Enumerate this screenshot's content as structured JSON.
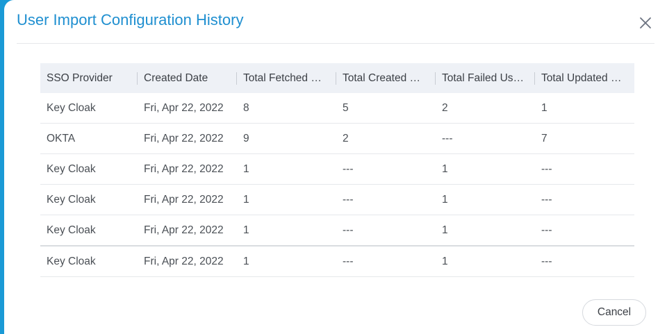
{
  "dialog": {
    "title": "User Import Configuration History",
    "cancel_label": "Cancel"
  },
  "table": {
    "columns": [
      "SSO Provider",
      "Created Date",
      "Total Fetched Users",
      "Total Created Users",
      "Total Failed Users",
      "Total Updated Users"
    ],
    "rows": [
      [
        "Key Cloak",
        "Fri, Apr 22, 2022",
        "8",
        "5",
        "2",
        "1"
      ],
      [
        "OKTA",
        "Fri, Apr 22, 2022",
        "9",
        "2",
        "---",
        "7"
      ],
      [
        "Key Cloak",
        "Fri, Apr 22, 2022",
        "1",
        "---",
        "1",
        "---"
      ],
      [
        "Key Cloak",
        "Fri, Apr 22, 2022",
        "1",
        "---",
        "1",
        "---"
      ],
      [
        "Key Cloak",
        "Fri, Apr 22, 2022",
        "1",
        "---",
        "1",
        "---"
      ],
      [
        "Key Cloak",
        "Fri, Apr 22, 2022",
        "1",
        "---",
        "1",
        "---"
      ]
    ]
  },
  "colors": {
    "title": "#1f8fd0",
    "header_bg": "#eef1f6",
    "backdrop_accent": "#1a9ad6"
  },
  "icons": {
    "close": "close-icon"
  }
}
